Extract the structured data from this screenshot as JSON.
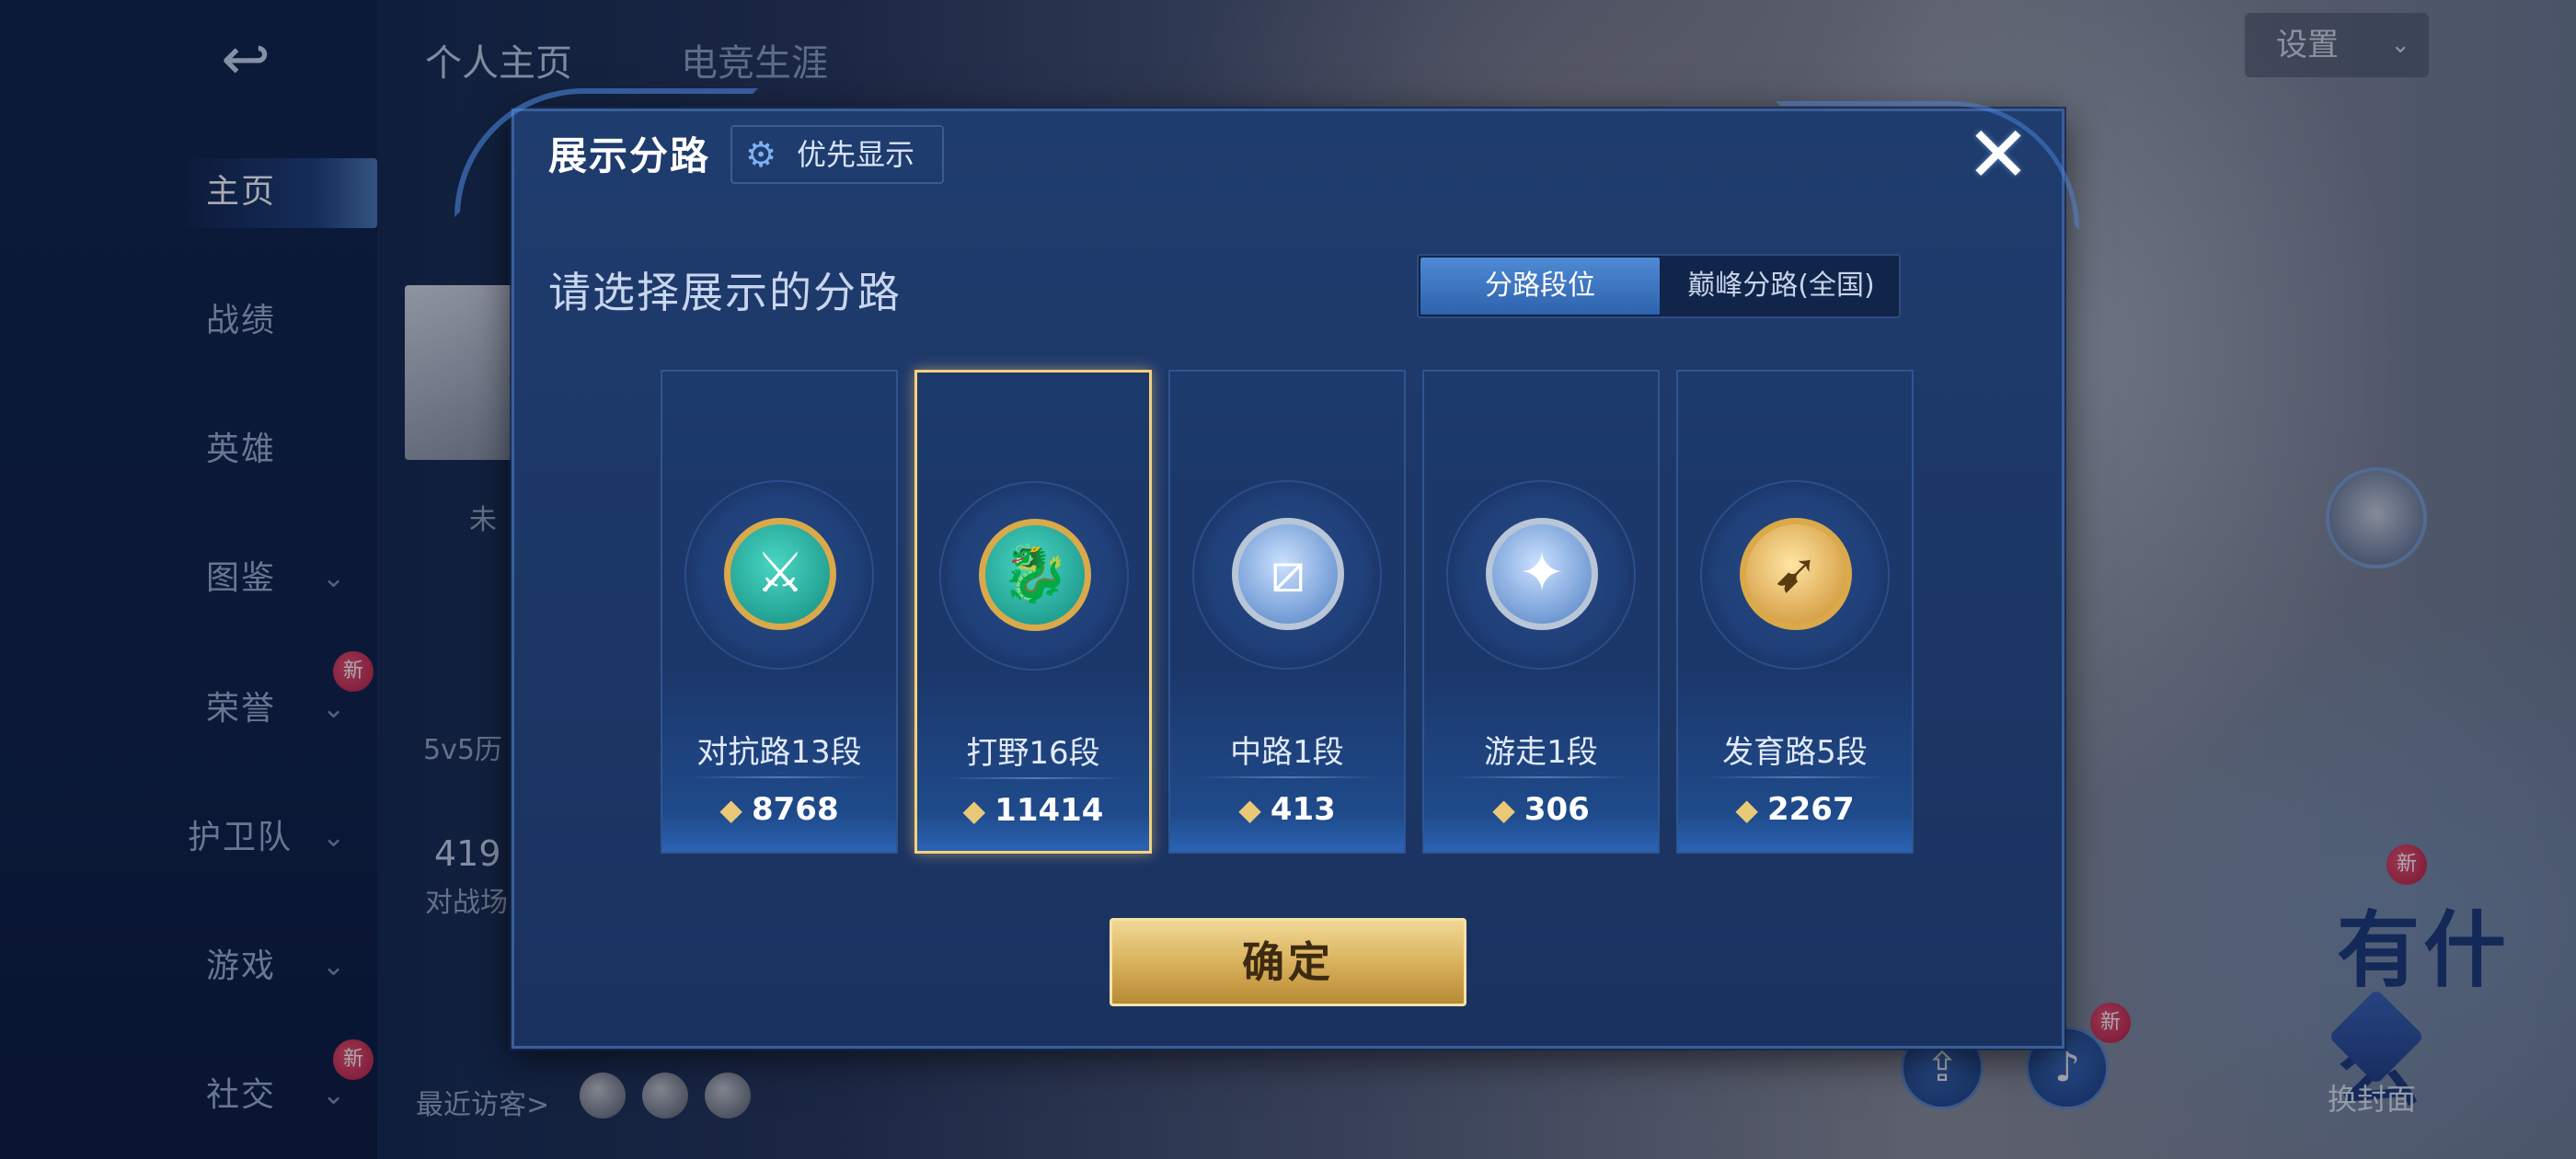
{
  "background": {
    "back_icon": "↩",
    "nav": [
      {
        "label": "主页",
        "active": true,
        "chevron": ""
      },
      {
        "label": "战绩",
        "active": false,
        "chevron": ""
      },
      {
        "label": "英雄",
        "active": false,
        "chevron": ""
      },
      {
        "label": "图鉴",
        "active": false,
        "chevron": "⌄"
      },
      {
        "label": "荣誉",
        "active": false,
        "chevron": "⌄"
      },
      {
        "label": "护卫队",
        "active": false,
        "chevron": "⌄"
      },
      {
        "label": "游戏",
        "active": false,
        "chevron": "⌄"
      },
      {
        "label": "社交",
        "active": false,
        "chevron": "⌄"
      }
    ],
    "new_badge": "新",
    "top_tabs": [
      "个人主页",
      "电竞生涯"
    ],
    "settings_label": "设置",
    "settings_chevron": "⌄",
    "partial_texts": {
      "status": "未",
      "history": "5v5历",
      "number": "419",
      "battle": "对战场",
      "visitors": "最近访客>"
    },
    "right_text": "有什么",
    "cover_label": "换封面",
    "round_btn_1_icon": "⇪",
    "round_btn_2_icon": "♪"
  },
  "modal": {
    "title": "展示分路",
    "priority_label": "优先显示",
    "priority_icon": "⚙",
    "close_icon": "✕",
    "prompt": "请选择展示的分路",
    "toggle": {
      "option_1": "分路段位",
      "option_2": "巅峰分路(全国)",
      "selected": "分路段位"
    },
    "lanes": [
      {
        "name": "对抗路13段",
        "score": "8768",
        "icon": "⚔",
        "selected": false
      },
      {
        "name": "打野16段",
        "score": "11414",
        "icon": "🐉",
        "selected": true
      },
      {
        "name": "中路1段",
        "score": "413",
        "icon": "⧄",
        "selected": false
      },
      {
        "name": "游走1段",
        "score": "306",
        "icon": "✦",
        "selected": false
      },
      {
        "name": "发育路5段",
        "score": "2267",
        "icon": "➹",
        "selected": false
      }
    ],
    "score_icon": "◆",
    "confirm_label": "确定"
  }
}
